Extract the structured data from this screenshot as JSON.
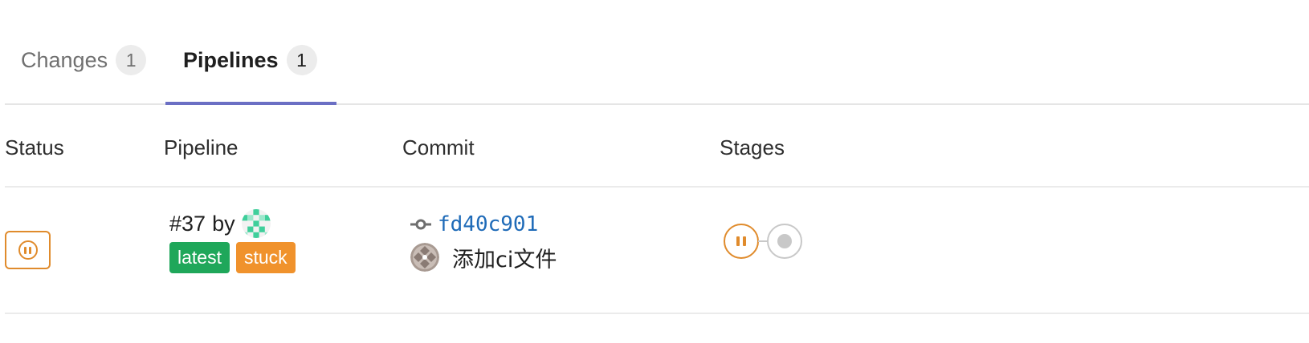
{
  "tabs": [
    {
      "label": "Changes",
      "count": "1"
    },
    {
      "label": "Pipelines",
      "count": "1"
    }
  ],
  "table": {
    "headers": {
      "status": "Status",
      "pipeline": "Pipeline",
      "commit": "Commit",
      "stages": "Stages"
    },
    "rows": [
      {
        "status_icon": "paused-status-icon",
        "pipeline_id": "#37",
        "by_text": "by",
        "labels": [
          "latest",
          "stuck"
        ],
        "commit_sha": "fd40c901",
        "commit_title": "添加ci文件",
        "stages": [
          "paused",
          "created"
        ]
      }
    ]
  },
  "colors": {
    "active_tab_underline": "#6b6fc4",
    "paused": "#e08b2c",
    "label_latest": "#1fa75a",
    "label_stuck": "#f0922c",
    "commit_link": "#1f6bb8",
    "stage_created": "#c8c8c8"
  }
}
